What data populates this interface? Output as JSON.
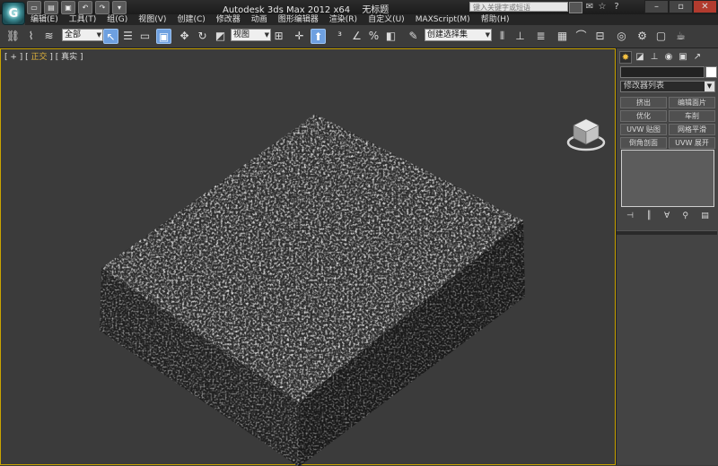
{
  "app": {
    "logo_glyph": "G",
    "title": "Autodesk 3ds Max  2012 x64",
    "document": "无标题",
    "search_placeholder": "键入关键字或短语"
  },
  "quick_access": [
    "new-icon",
    "open-icon",
    "save-icon",
    "undo-icon",
    "redo-icon",
    "dropdown-icon"
  ],
  "menu": [
    "编辑(E)",
    "工具(T)",
    "组(G)",
    "视图(V)",
    "创建(C)",
    "修改器",
    "动画",
    "图形编辑器",
    "渲染(R)",
    "自定义(U)",
    "MAXScript(M)",
    "帮助(H)"
  ],
  "toolbar": {
    "selection_filter": "全部",
    "reference_coord": "视图",
    "named_selection": "创建选择集"
  },
  "viewport": {
    "label_plus": "+",
    "label_view": "正交",
    "label_shading": "真实",
    "object_texture": "sponge-noise"
  },
  "command_panel": {
    "modifier_list": "修改器列表",
    "modifier_buttons": [
      "挤出",
      "编辑面片",
      "优化",
      "车削",
      "UVW 贴图",
      "网格平滑",
      "倒角剖面",
      "UVW 展开"
    ]
  },
  "colors": {
    "accent_active": "#6ea0e0",
    "viewport_border": "#c9a400",
    "close_button": "#b23b2e"
  }
}
